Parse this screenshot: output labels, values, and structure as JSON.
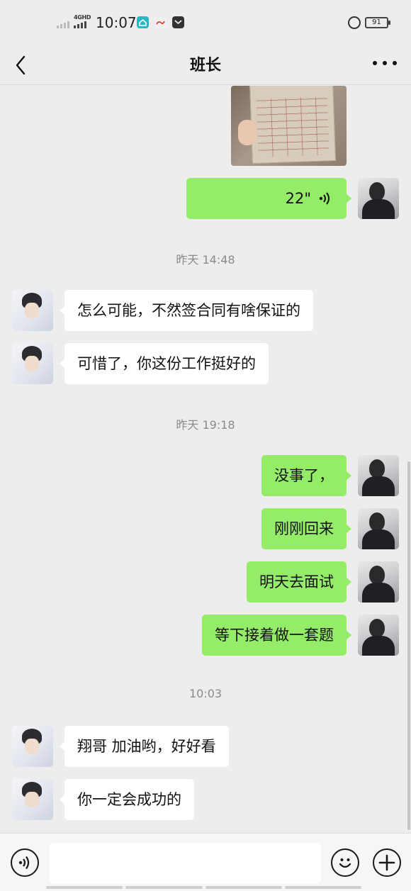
{
  "status_bar": {
    "network": "4GHD",
    "time": "10:07",
    "battery": "91",
    "icons": [
      "signal-icon",
      "home-app-icon",
      "news-app-icon",
      "inbox-app-icon",
      "alarm-icon",
      "battery-icon"
    ]
  },
  "header": {
    "title": "班长",
    "back_icon": "chevron-left-icon",
    "more_icon": "more-icon"
  },
  "messages": {
    "voice_duration": "22\"",
    "ts1": "昨天 14:48",
    "m1": "怎么可能，不然签合同有啥保证的",
    "m2": "可惜了，你这份工作挺好的",
    "ts2": "昨天 19:18",
    "m3": "没事了，",
    "m4": "刚刚回来",
    "m5": "明天去面试",
    "m6": "等下接着做一套题",
    "ts3": "10:03",
    "m7": "翔哥 加油哟，好好看",
    "m8": "你一定会成功的"
  },
  "input_bar": {
    "voice_icon": "voice-input-icon",
    "emoji_icon": "emoji-icon",
    "plus_icon": "plus-icon",
    "placeholder": ""
  },
  "colors": {
    "background": "#ededed",
    "outgoing_bubble": "#95ec69",
    "incoming_bubble": "#ffffff",
    "timestamp": "#8a8a8a"
  }
}
